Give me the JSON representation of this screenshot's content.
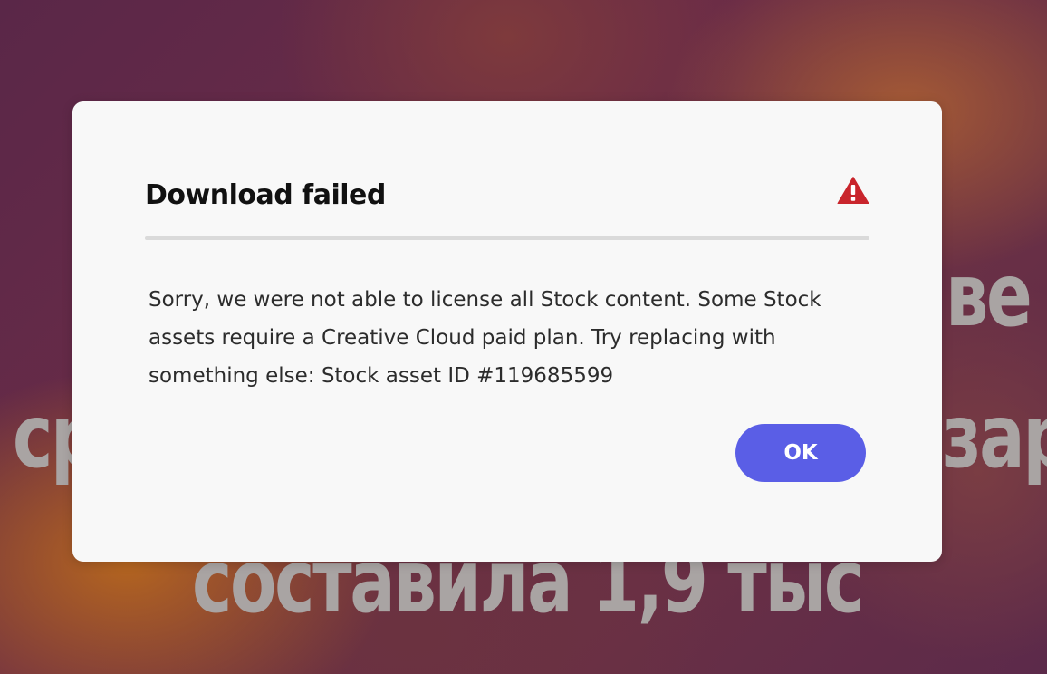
{
  "background": {
    "text_line_1": "ве",
    "text_line_2": "ср",
    "text_line_2_right": "зар",
    "text_line_3": "составила 1,9 тыс"
  },
  "dialog": {
    "title": "Download failed",
    "icon": "alert-triangle-icon",
    "message": "Sorry, we were not able to license all Stock content. Some Stock assets require a Creative Cloud paid plan. Try replacing with something else: Stock asset ID #119685599",
    "ok_label": "OK"
  },
  "colors": {
    "dialog_background": "#f8f8f8",
    "primary_button": "#5a5ee6",
    "alert_icon": "#c9252c",
    "divider": "#dadada"
  }
}
